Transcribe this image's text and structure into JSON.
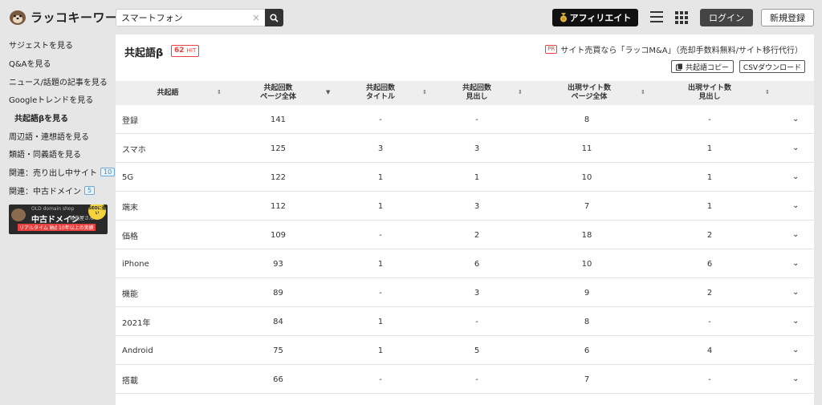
{
  "header": {
    "logo_text": "ラッコキーワード",
    "search_value": "スマートフォン",
    "clear_glyph": "×",
    "affiliate_label": "アフィリエイト",
    "login_label": "ログイン",
    "register_label": "新規登録"
  },
  "sidebar": {
    "items": [
      {
        "label": "サジェストを見る"
      },
      {
        "label": "Q&Aを見る"
      },
      {
        "label": "ニュース/話題の記事を見る"
      },
      {
        "label": "Googleトレンドを見る"
      },
      {
        "label": "共起語βを見る"
      },
      {
        "label": "周辺語・連想語を見る"
      },
      {
        "label": "類語・同義語を見る"
      },
      {
        "label": "関連：売り出し中サイト",
        "badge": "10"
      },
      {
        "label": "関連：中古ドメイン",
        "badge": "5"
      }
    ],
    "banner": {
      "small_text": "OLD domain shop",
      "main_text": "中古ドメイン",
      "sub_text": "販売屋さん",
      "tag1": "リアルタイム 納品",
      "tag2": "10年以上の実績",
      "seal": "SEOに強い"
    }
  },
  "main": {
    "title": "共起語β",
    "hit_count": "62",
    "hit_unit": "HIT",
    "pr_tag": "PR",
    "pr_text": "サイト売買なら「ラッコM&A」（売却手数料無料/サイト移行代行）",
    "copy_label": "共起語コピー",
    "csv_label": "CSVダウンロード",
    "columns": [
      {
        "line1": "共起語",
        "line2": ""
      },
      {
        "line1": "共起回数",
        "line2": "ページ全体"
      },
      {
        "line1": "共起回数",
        "line2": "タイトル"
      },
      {
        "line1": "共起回数",
        "line2": "見出し"
      },
      {
        "line1": "出現サイト数",
        "line2": "ページ全体"
      },
      {
        "line1": "出現サイト数",
        "line2": "見出し"
      }
    ],
    "sort_glyph": "⇕",
    "sort_active_glyph": "▼",
    "chevron_glyph": "⌄",
    "rows": [
      {
        "word": "登録",
        "c1": "141",
        "c2": "-",
        "c3": "-",
        "c4": "8",
        "c5": "-"
      },
      {
        "word": "スマホ",
        "c1": "125",
        "c2": "3",
        "c3": "3",
        "c4": "11",
        "c5": "1"
      },
      {
        "word": "5G",
        "c1": "122",
        "c2": "1",
        "c3": "1",
        "c4": "10",
        "c5": "1"
      },
      {
        "word": "端末",
        "c1": "112",
        "c2": "1",
        "c3": "3",
        "c4": "7",
        "c5": "1"
      },
      {
        "word": "価格",
        "c1": "109",
        "c2": "-",
        "c3": "2",
        "c4": "18",
        "c5": "2"
      },
      {
        "word": "iPhone",
        "c1": "93",
        "c2": "1",
        "c3": "6",
        "c4": "10",
        "c5": "6"
      },
      {
        "word": "機能",
        "c1": "89",
        "c2": "-",
        "c3": "3",
        "c4": "9",
        "c5": "2"
      },
      {
        "word": "2021年",
        "c1": "84",
        "c2": "1",
        "c3": "-",
        "c4": "8",
        "c5": "-"
      },
      {
        "word": "Android",
        "c1": "75",
        "c2": "1",
        "c3": "5",
        "c4": "6",
        "c5": "4"
      },
      {
        "word": "搭載",
        "c1": "66",
        "c2": "-",
        "c3": "-",
        "c4": "7",
        "c5": "-"
      }
    ]
  }
}
